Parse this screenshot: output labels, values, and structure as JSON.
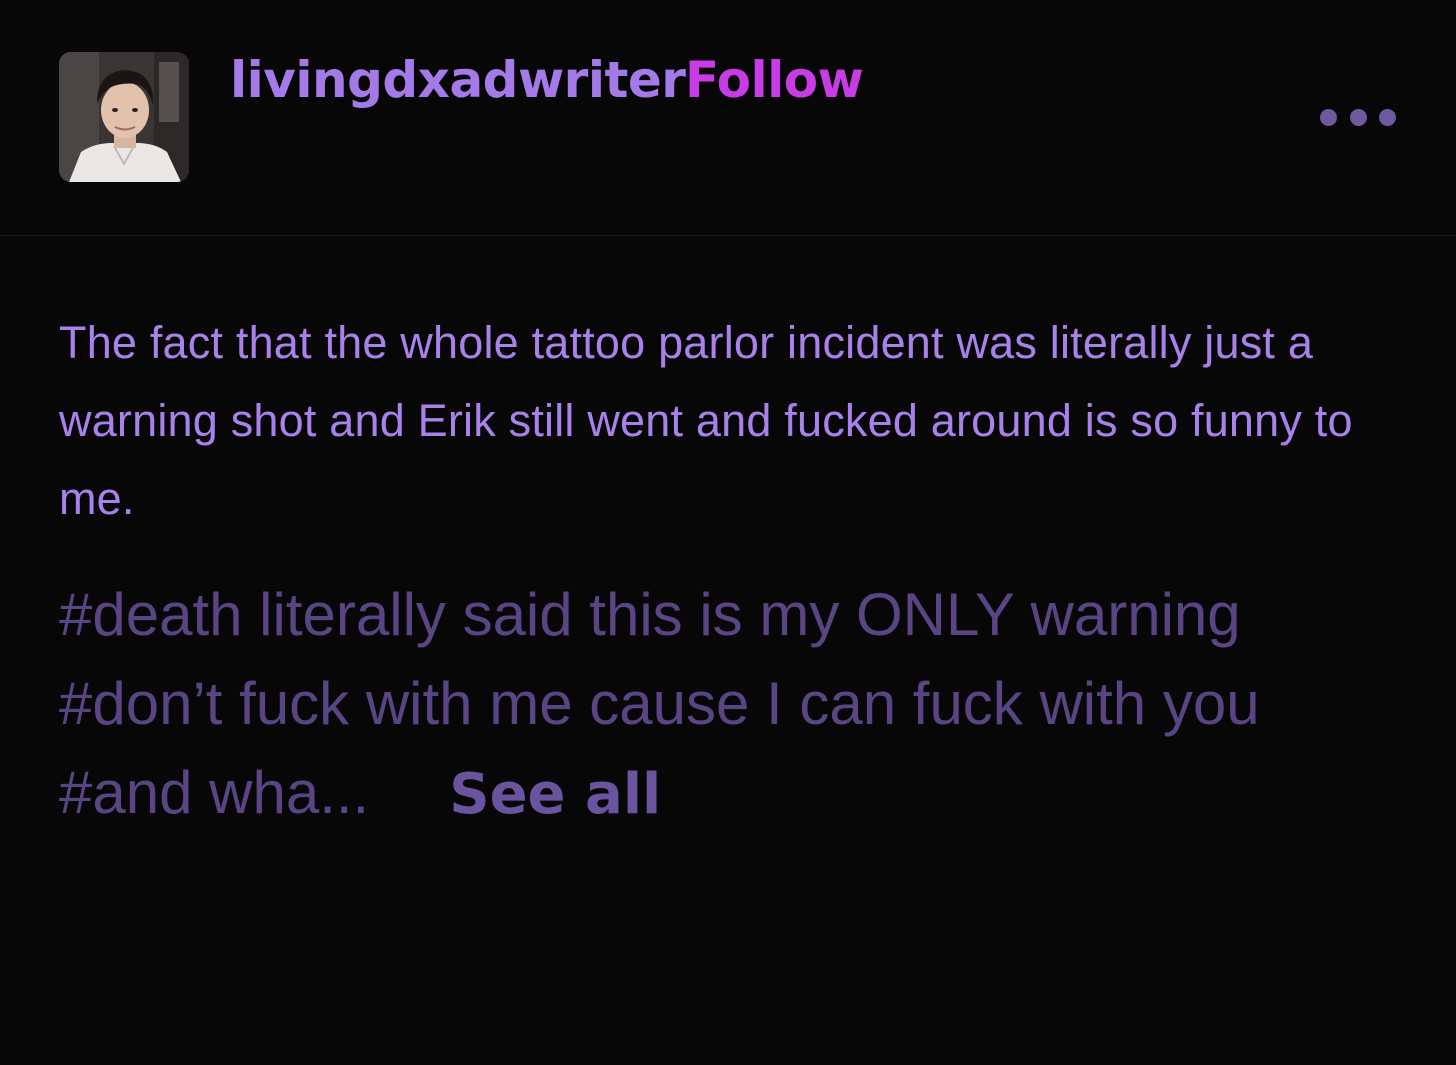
{
  "post": {
    "author": "livingdxadwriter",
    "follow_label": "Follow",
    "more_menu": {
      "icon": "more-horizontal-icon"
    },
    "body": "The fact that the whole tattoo parlor incident was literally just a warning shot and Erik still went and fucked around is so funny to me.",
    "tags": [
      "#death literally said this is my ONLY warning",
      "#don’t fuck with me cause I can fuck with you",
      "#and wha..."
    ],
    "see_all_label": "See all"
  },
  "colors": {
    "background": "#080708",
    "author": "#a47ae8",
    "follow": "#c83ce6",
    "body_text": "#a882ea",
    "tags": "#5a4584",
    "see_all": "#6a54a0",
    "menu_dots": "#6d5a9e"
  }
}
